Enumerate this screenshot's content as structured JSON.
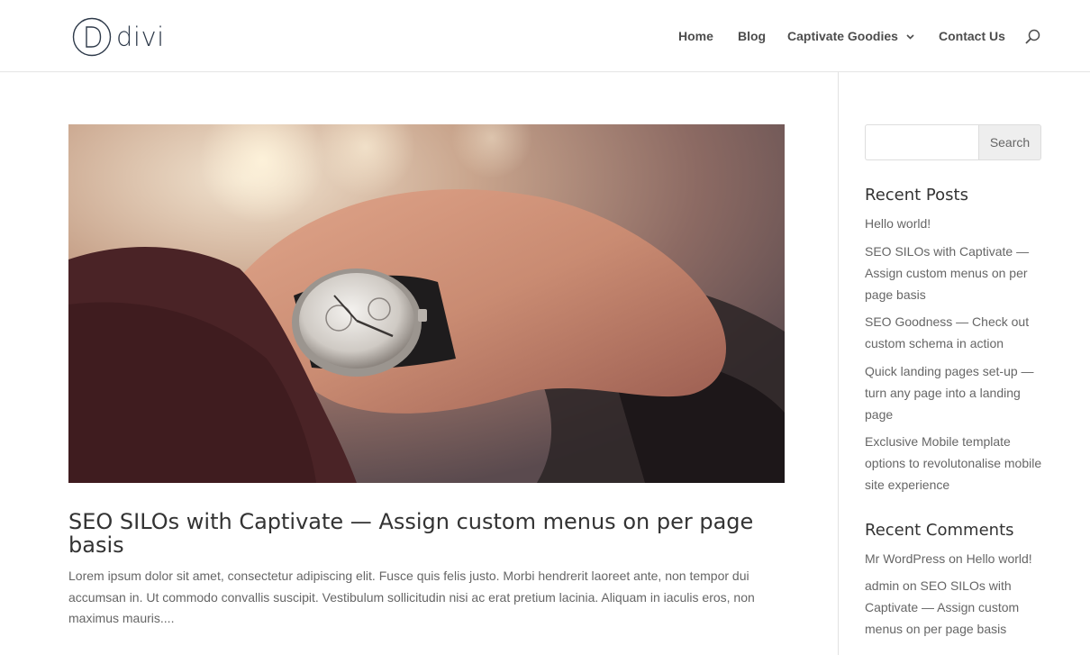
{
  "logo": {
    "text": "divi",
    "mark_letter": "D"
  },
  "nav": {
    "items": [
      {
        "label": "Home"
      },
      {
        "label": "Blog"
      },
      {
        "label": "Captivate Goodies",
        "has_dropdown": true
      },
      {
        "label": "Contact Us"
      }
    ]
  },
  "post": {
    "title": "SEO SILOs with Captivate — Assign custom menus on per page basis",
    "excerpt": "Lorem ipsum dolor sit amet, consectetur adipiscing elit. Fusce quis felis justo. Morbi hendrerit laoreet ante, non tempor dui accumsan in. Ut commodo convallis suscipit. Vestibulum sollicitudin nisi ac erat pretium lacinia. Aliquam in iaculis eros, non maximus mauris....",
    "image_alt": "wristwatch on hand"
  },
  "sidebar": {
    "search": {
      "placeholder": "",
      "value": "",
      "button_label": "Search"
    },
    "recent_posts": {
      "title": "Recent Posts",
      "items": [
        "Hello world!",
        "SEO SILOs with Captivate — Assign custom menus on per page basis",
        "SEO Goodness — Check out custom schema in action",
        "Quick landing pages set-up — turn any page into a landing page",
        "Exclusive Mobile template options to revolutonalise mobile site experience"
      ]
    },
    "recent_comments": {
      "title": "Recent Comments",
      "items": [
        {
          "author": "Mr WordPress",
          "on": "on",
          "post": "Hello world!"
        },
        {
          "author": "admin",
          "on": "on",
          "post": "SEO SILOs with Captivate — Assign custom menus on per page basis"
        }
      ]
    }
  },
  "colors": {
    "text": "#666666",
    "heading": "#333333",
    "nav": "#4d4d4d",
    "border": "#e2e2e2",
    "button_bg": "#eeeeee"
  },
  "icons": {
    "search": "search-icon",
    "dropdown": "chevron-down-icon"
  }
}
